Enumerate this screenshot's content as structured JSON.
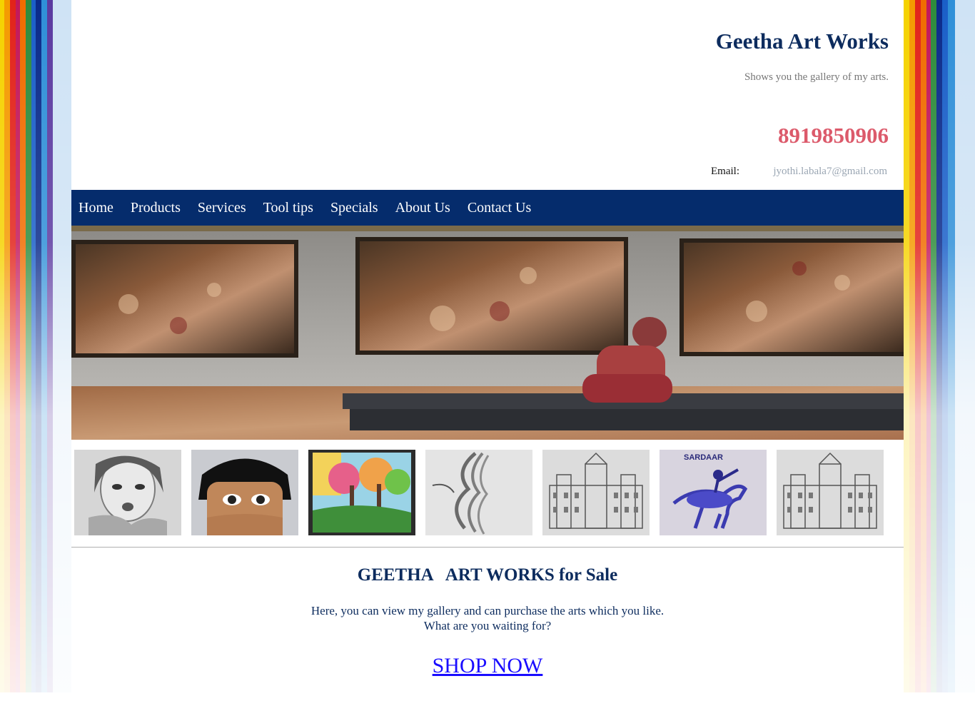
{
  "site": {
    "title": "Geetha Art Works",
    "tagline": "Shows you the gallery of my arts.",
    "phone": "8919850906",
    "email_label": "Email:",
    "email": "jyothi.labala7@gmail.com"
  },
  "nav": {
    "items": [
      {
        "label": "Home"
      },
      {
        "label": "Products"
      },
      {
        "label": "Services"
      },
      {
        "label": "Tool tips"
      },
      {
        "label": "Specials"
      },
      {
        "label": "About Us"
      },
      {
        "label": "Contact Us"
      }
    ]
  },
  "thumbnails": [
    {
      "icon": "pencil-sketch-face-artwork"
    },
    {
      "icon": "painted-eyes-artwork"
    },
    {
      "icon": "colorful-tree-painting"
    },
    {
      "icon": "hair-sketch-artwork"
    },
    {
      "icon": "palace-sketch-artwork"
    },
    {
      "icon": "horse-rider-sketch",
      "caption": "SARDAAR"
    },
    {
      "icon": "palace-sketch-artwork"
    }
  ],
  "sale": {
    "heading": "GEETHA   ART WORKS for Sale",
    "line1": "Here, you can view my gallery and can purchase the arts which you like.",
    "line2": "What are you waiting for?",
    "cta": "SHOP NOW"
  },
  "colors": {
    "nav_bg": "#052c6c",
    "title": "#0d2c5e",
    "phone": "#dc5a6b",
    "link": "#1a0dff"
  }
}
